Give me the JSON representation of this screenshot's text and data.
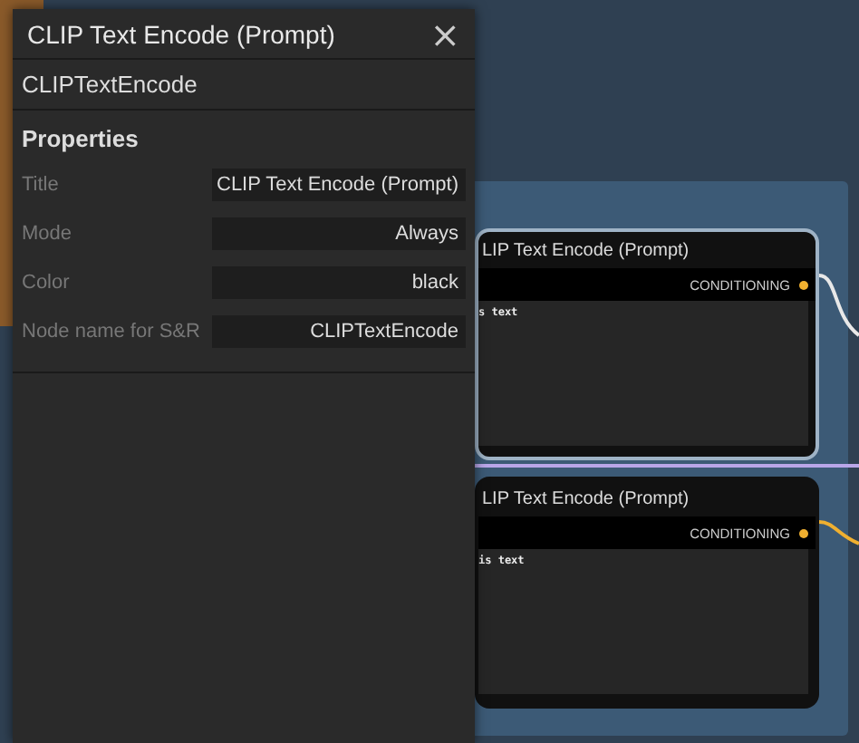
{
  "panel": {
    "title": "CLIP Text Encode (Prompt)",
    "close_icon": "×",
    "node_type": "CLIPTextEncode",
    "section": "Properties",
    "properties": [
      {
        "label": "Title",
        "value": "CLIP Text Encode (Prompt)"
      },
      {
        "label": "Mode",
        "value": "Always"
      },
      {
        "label": "Color",
        "value": "black"
      },
      {
        "label": "Node name for S&R",
        "value": "CLIPTextEncode"
      }
    ]
  },
  "nodes": [
    {
      "title": "LIP Text Encode (Prompt)",
      "output": "CONDITIONING",
      "text": "s text",
      "selected": true
    },
    {
      "title": "LIP Text Encode (Prompt)",
      "output": "CONDITIONING",
      "text": "is text",
      "selected": false
    }
  ]
}
